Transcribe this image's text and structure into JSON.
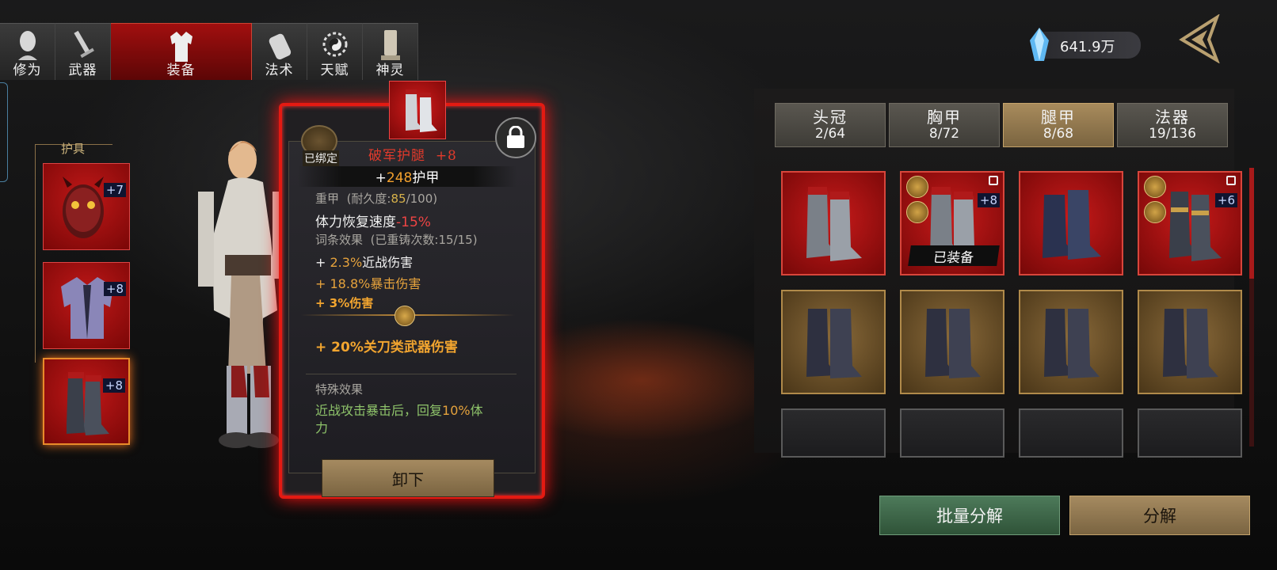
{
  "top_tabs": [
    {
      "label": "修为",
      "icon": "person-icon",
      "active": false
    },
    {
      "label": "武器",
      "icon": "sword-icon",
      "active": false
    },
    {
      "label": "装备",
      "icon": "robe-icon",
      "active": true
    },
    {
      "label": "法术",
      "icon": "scroll-icon",
      "active": false
    },
    {
      "label": "天赋",
      "icon": "bagua-icon",
      "active": false
    },
    {
      "label": "神灵",
      "icon": "tablet-icon",
      "active": false
    }
  ],
  "equip_section": {
    "title": "护具",
    "slots": [
      {
        "name": "helmet-mask",
        "enhance": "+7"
      },
      {
        "name": "chest-robe",
        "enhance": "+8"
      },
      {
        "name": "leg-boots",
        "enhance": "+8",
        "selected": true
      }
    ]
  },
  "tooltip": {
    "bound_label": "已绑定",
    "item_name": "破军护腿",
    "item_enhance": "+8",
    "armor_prefix": "+",
    "armor_value": "248",
    "armor_label": "护甲",
    "weight_type": "重甲",
    "durability_label": "(耐久度:",
    "durability_value": "85",
    "durability_max": "/100)",
    "stamina_label": "体力恢复速度",
    "stamina_value": "-15%",
    "affix_title": "词条效果",
    "affix_recast": "(已重铸次数:15/15)",
    "affix_1_prefix": "+ ",
    "affix_1_value": "2.3%",
    "affix_1_label": "近战伤害",
    "affix_2": "+ 18.8%暴击伤害",
    "affix_3": "+ 3%伤害",
    "affix_4": "+ 20%关刀类武器伤害",
    "special_title": "特殊效果",
    "special_text_1": "近战攻击暴击后，回复",
    "special_value": "10%",
    "special_text_2": "体",
    "special_text_3": "力",
    "unequip_label": "卸下"
  },
  "currency": {
    "value": "641.9万",
    "icon": "crystal-icon"
  },
  "category_tabs": [
    {
      "name": "头冠",
      "count": "2/64",
      "active": false
    },
    {
      "name": "胸甲",
      "count": "8/72",
      "active": false
    },
    {
      "name": "腿甲",
      "count": "8/68",
      "active": true
    },
    {
      "name": "法器",
      "count": "19/136",
      "active": false
    }
  ],
  "inventory": [
    {
      "rarity": "red",
      "enhance": "",
      "locked": false,
      "bagua": false,
      "bound": false,
      "equipped": false
    },
    {
      "rarity": "red",
      "enhance": "+8",
      "locked": true,
      "bagua": true,
      "bound": true,
      "equipped": true,
      "equipped_label": "已装备"
    },
    {
      "rarity": "red",
      "enhance": "",
      "locked": false,
      "bagua": false,
      "bound": false,
      "equipped": false
    },
    {
      "rarity": "red",
      "enhance": "+6",
      "locked": true,
      "bagua": true,
      "bound": true,
      "equipped": false
    },
    {
      "rarity": "gold",
      "enhance": ""
    },
    {
      "rarity": "gold",
      "enhance": ""
    },
    {
      "rarity": "gold",
      "enhance": ""
    },
    {
      "rarity": "gold",
      "enhance": ""
    },
    {
      "rarity": "empty"
    },
    {
      "rarity": "empty"
    },
    {
      "rarity": "empty"
    },
    {
      "rarity": "empty"
    }
  ],
  "actions": {
    "batch_label": "批量分解",
    "decompose_label": "分解"
  }
}
